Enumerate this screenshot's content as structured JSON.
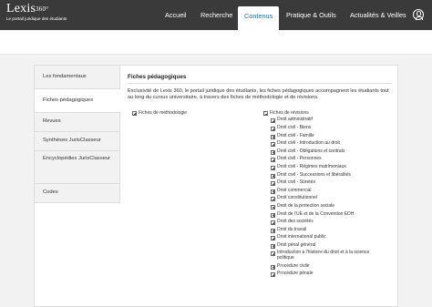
{
  "header": {
    "logo_text": "Lexis",
    "logo_sup": "360°",
    "logo_tagline": "Le portail juridique des étudiants",
    "nav": [
      "Accueil",
      "Recherche",
      "Contenus",
      "Pratique & Outils",
      "Actualités & Veilles"
    ],
    "active_nav": "Contenus"
  },
  "sidebar": {
    "items": [
      {
        "label": "Les fondamentaux"
      },
      {
        "label": "Fiches pédagogiques"
      },
      {
        "label": "Revues"
      },
      {
        "label": "Synthèses JurisClasseur"
      },
      {
        "label": "Encyclopédies JurisClasseur"
      },
      {
        "label": "Codes"
      }
    ],
    "active": "Fiches pédagogiques"
  },
  "main": {
    "title": "Fiches pédagogiques",
    "description": "Exclusivité de Lexis 360, le portail juridique des étudiants, les fiches pédagogiques accompagnent les étudiants tout au long du cursus universitaire, à travers des fiches de méthodologie et de révisions.",
    "tree_left": {
      "label": "Fiches de méthodologie"
    },
    "tree_right": {
      "label": "Fiches de révisions",
      "children": [
        "Droit administratif",
        "Droit civil - Biens",
        "Droit civil - Famille",
        "Droit civil - Introduction au droit",
        "Droit civil - Obligations et contrats",
        "Droit civil - Personnes",
        "Droit civil - Régimes matrimoniaux",
        "Droit civil - Successions et libéralités",
        "Droit civil - Sûretés",
        "Droit commercial",
        "Droit constitutionnel",
        "Droit de la protection sociale",
        "Droit de l'UE et de la Convention EDH",
        "Droit des sociétés",
        "Droit du travail",
        "Droit international public",
        "Droit pénal général",
        "Introduction à l'histoire du droit et à la science politique",
        "Procédure civile",
        "Procédure pénale"
      ]
    }
  }
}
